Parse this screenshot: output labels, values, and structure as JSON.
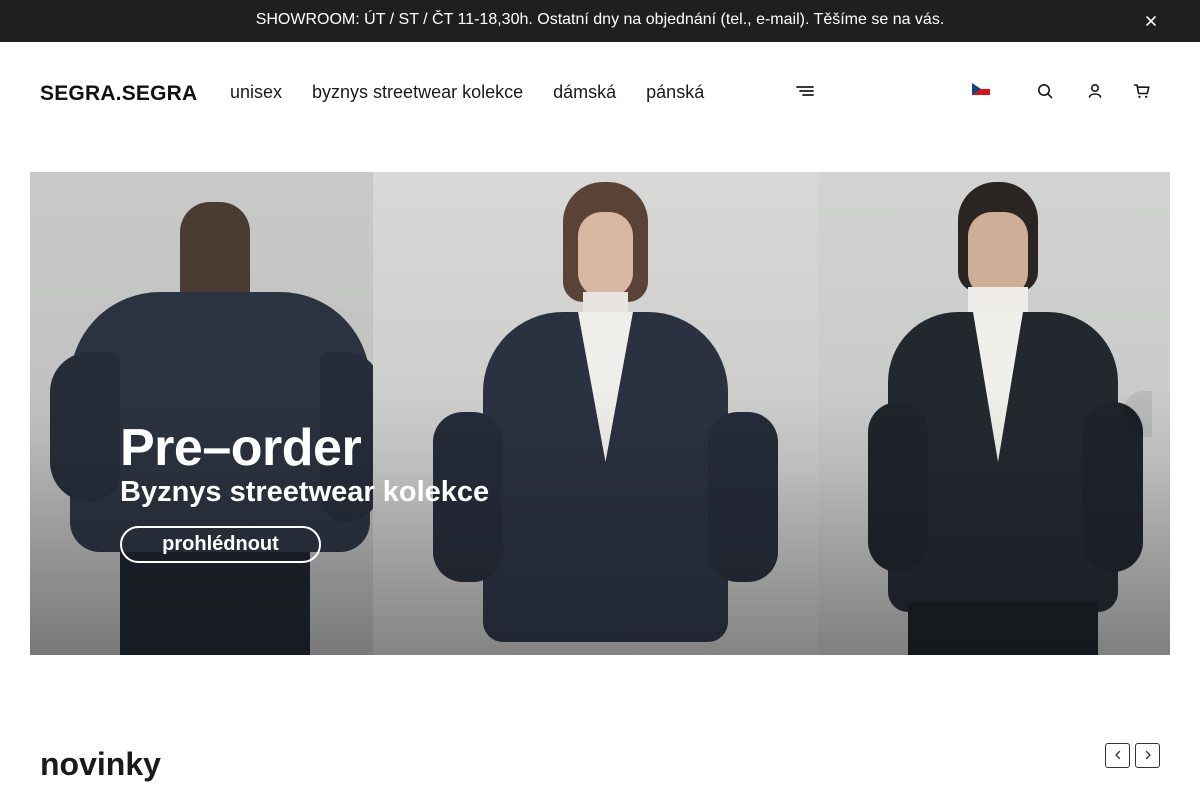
{
  "announcement": {
    "text": "SHOWROOM: ÚT / ST / ČT 11-18,30h. Ostatní dny na objednání (tel., e-mail). Těšíme se na vás.",
    "close_icon": "close-icon"
  },
  "header": {
    "logo": "SEGRA.SEGRA",
    "nav": [
      "unisex",
      "byznys streetwear kolekce",
      "dámská",
      "pánská"
    ],
    "menu_icon": "hamburger-icon",
    "language": {
      "flag": "czech-flag-icon",
      "caret": ""
    },
    "icons": [
      "search-icon",
      "user-icon",
      "cart-icon"
    ]
  },
  "hero": {
    "title": "Pre–order",
    "subtitle": "Byznys streetwear kolekce",
    "button_label": "prohlédnout",
    "prev_glyph": ""
  },
  "section": {
    "title": "novinky",
    "prev_icon": "chevron-left-icon",
    "next_icon": "chevron-right-icon"
  },
  "colors": {
    "announcement_bg": "#1f1f1f",
    "text": "#1a1a1a",
    "hero_text": "#ffffff"
  }
}
